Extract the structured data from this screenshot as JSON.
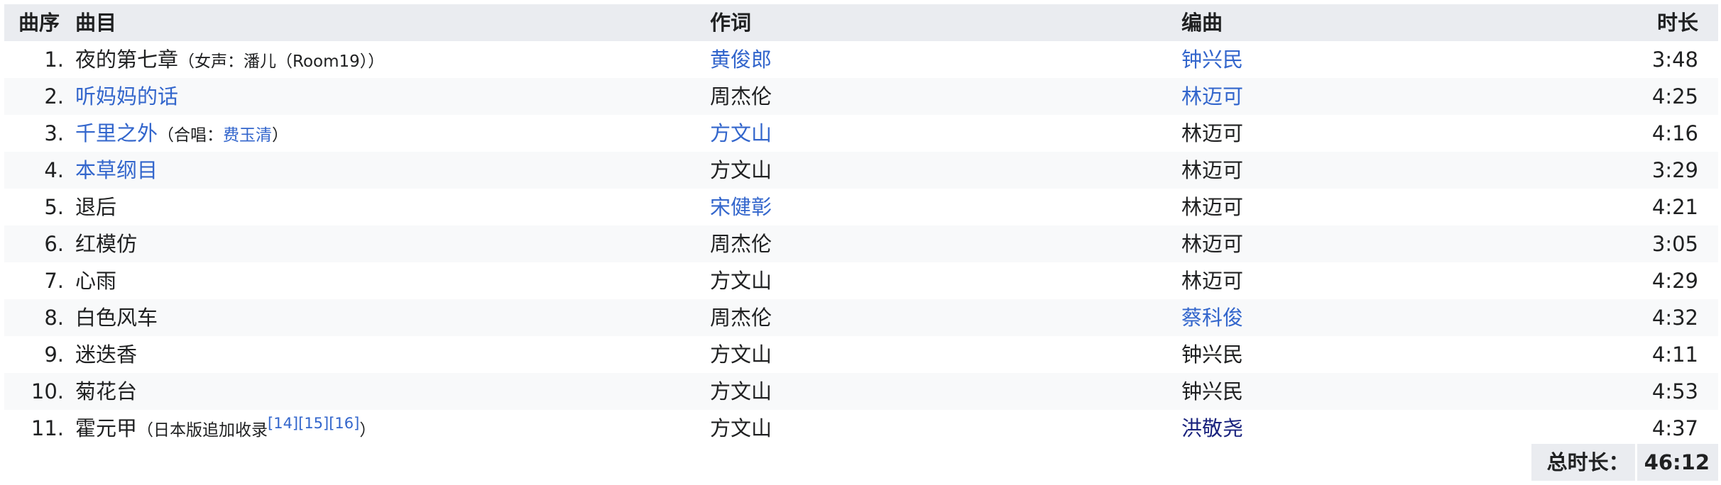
{
  "header": {
    "no": "曲序",
    "title": "曲目",
    "lyricist": "作词",
    "arranger": "编曲",
    "duration": "时长"
  },
  "tracks": [
    {
      "no": "1.",
      "title": "夜的第七章",
      "note_pre": "（女声：潘儿（Room19））",
      "note_link": "",
      "note_post": "",
      "refs": "",
      "lyricist": "黄俊郎",
      "arranger": "钟兴民",
      "duration": "3:48"
    },
    {
      "no": "2.",
      "title": "听妈妈的话",
      "note_pre": "",
      "note_link": "",
      "note_post": "",
      "refs": "",
      "lyricist": "周杰伦",
      "arranger": "林迈可",
      "duration": "4:25"
    },
    {
      "no": "3.",
      "title": "千里之外",
      "note_pre": "（合唱：",
      "note_link": "费玉清",
      "note_post": "）",
      "refs": "",
      "lyricist": "方文山",
      "arranger": "林迈可",
      "duration": "4:16"
    },
    {
      "no": "4.",
      "title": "本草纲目",
      "note_pre": "",
      "note_link": "",
      "note_post": "",
      "refs": "",
      "lyricist": "方文山",
      "arranger": "林迈可",
      "duration": "3:29"
    },
    {
      "no": "5.",
      "title": "退后",
      "note_pre": "",
      "note_link": "",
      "note_post": "",
      "refs": "",
      "lyricist": "宋健彰",
      "arranger": "林迈可",
      "duration": "4:21"
    },
    {
      "no": "6.",
      "title": "红模仿",
      "note_pre": "",
      "note_link": "",
      "note_post": "",
      "refs": "",
      "lyricist": "周杰伦",
      "arranger": "林迈可",
      "duration": "3:05"
    },
    {
      "no": "7.",
      "title": "心雨",
      "note_pre": "",
      "note_link": "",
      "note_post": "",
      "refs": "",
      "lyricist": "方文山",
      "arranger": "林迈可",
      "duration": "4:29"
    },
    {
      "no": "8.",
      "title": "白色风车",
      "note_pre": "",
      "note_link": "",
      "note_post": "",
      "refs": "",
      "lyricist": "周杰伦",
      "arranger": "蔡科俊",
      "duration": "4:32"
    },
    {
      "no": "9.",
      "title": "迷迭香",
      "note_pre": "",
      "note_link": "",
      "note_post": "",
      "refs": "",
      "lyricist": "方文山",
      "arranger": "钟兴民",
      "duration": "4:11"
    },
    {
      "no": "10.",
      "title": "菊花台",
      "note_pre": "",
      "note_link": "",
      "note_post": "",
      "refs": "",
      "lyricist": "方文山",
      "arranger": "钟兴民",
      "duration": "4:53"
    },
    {
      "no": "11.",
      "title": "霍元甲",
      "note_pre": "（日本版追加收录",
      "note_link": "",
      "note_post": "）",
      "refs": "[14][15][16]",
      "lyricist": "方文山",
      "arranger": "洪敬尧",
      "duration": "4:37"
    }
  ],
  "links": {
    "title": [
      false,
      true,
      true,
      true,
      false,
      false,
      false,
      false,
      false,
      false,
      false
    ],
    "lyricist": [
      true,
      false,
      true,
      false,
      true,
      false,
      false,
      false,
      false,
      false,
      false
    ],
    "arranger": [
      true,
      true,
      false,
      false,
      false,
      false,
      false,
      true,
      false,
      false,
      true
    ]
  },
  "total": {
    "label": "总时长：",
    "value": "46:12"
  },
  "colors": {
    "link": "#3366cc",
    "visited_link": "#1a237e",
    "header_bg": "#eaecf0",
    "stripe_bg": "#f8f9fa",
    "text": "#202122"
  }
}
